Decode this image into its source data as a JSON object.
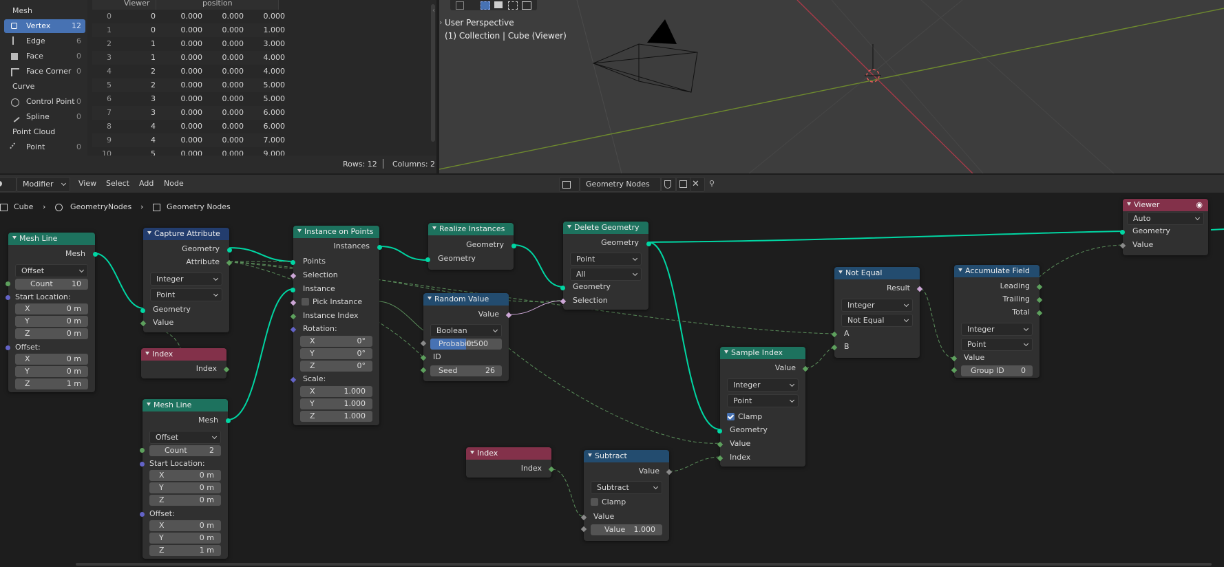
{
  "spreadsheet": {
    "sidebar": {
      "groups": {
        "mesh": "Mesh",
        "curve": "Curve",
        "point_cloud": "Point Cloud"
      },
      "items": {
        "vertex": {
          "label": "Vertex",
          "count": "12"
        },
        "edge": {
          "label": "Edge",
          "count": "6"
        },
        "face": {
          "label": "Face",
          "count": "0"
        },
        "face_corner": {
          "label": "Face Corner",
          "count": "0"
        },
        "control_point": {
          "label": "Control Point",
          "count": "0"
        },
        "spline": {
          "label": "Spline",
          "count": "0"
        },
        "point": {
          "label": "Point",
          "count": "0"
        }
      }
    },
    "columns": {
      "viewer": "Viewer",
      "position": "position"
    },
    "rows": [
      [
        "0",
        "0",
        "0.000",
        "0.000",
        "0.000"
      ],
      [
        "1",
        "0",
        "0.000",
        "0.000",
        "1.000"
      ],
      [
        "2",
        "1",
        "0.000",
        "0.000",
        "3.000"
      ],
      [
        "3",
        "1",
        "0.000",
        "0.000",
        "4.000"
      ],
      [
        "4",
        "2",
        "0.000",
        "0.000",
        "4.000"
      ],
      [
        "5",
        "2",
        "0.000",
        "0.000",
        "5.000"
      ],
      [
        "6",
        "3",
        "0.000",
        "0.000",
        "5.000"
      ],
      [
        "7",
        "3",
        "0.000",
        "0.000",
        "6.000"
      ],
      [
        "8",
        "4",
        "0.000",
        "0.000",
        "6.000"
      ],
      [
        "9",
        "4",
        "0.000",
        "0.000",
        "7.000"
      ],
      [
        "10",
        "5",
        "0.000",
        "0.000",
        "9.000"
      ]
    ],
    "footer": {
      "rows": "Rows: 12",
      "columns": "Columns: 2"
    }
  },
  "viewport": {
    "perspective": "User Perspective",
    "collection": "(1) Collection | Cube (Viewer)"
  },
  "editor": {
    "header": {
      "mode": "Modifier",
      "menus": {
        "view": "View",
        "select": "Select",
        "add": "Add",
        "node": "Node"
      },
      "tree_name": "Geometry Nodes"
    },
    "breadcrumb": {
      "object": "Cube",
      "modifier": "GeometryNodes",
      "tree": "Geometry Nodes"
    }
  },
  "nodes": {
    "mesh_line_1": {
      "title": "Mesh Line",
      "out_mesh": "Mesh",
      "mode": "Offset",
      "count_label": "Count",
      "count": "10",
      "start_location": "Start Location:",
      "offset": "Offset:",
      "start": [
        {
          "axis": "X",
          "val": "0 m"
        },
        {
          "axis": "Y",
          "val": "0 m"
        },
        {
          "axis": "Z",
          "val": "0 m"
        }
      ],
      "off": [
        {
          "axis": "X",
          "val": "0 m"
        },
        {
          "axis": "Y",
          "val": "0 m"
        },
        {
          "axis": "Z",
          "val": "1 m"
        }
      ]
    },
    "capture": {
      "title": "Capture Attribute",
      "out_geometry": "Geometry",
      "out_attribute": "Attribute",
      "type": "Integer",
      "domain": "Point",
      "in_geometry": "Geometry",
      "in_value": "Value"
    },
    "index_1": {
      "title": "Index",
      "out": "Index"
    },
    "mesh_line_2": {
      "title": "Mesh Line",
      "out_mesh": "Mesh",
      "mode": "Offset",
      "count_label": "Count",
      "count": "2",
      "start_location": "Start Location:",
      "offset": "Offset:",
      "start": [
        {
          "axis": "X",
          "val": "0 m"
        },
        {
          "axis": "Y",
          "val": "0 m"
        },
        {
          "axis": "Z",
          "val": "0 m"
        }
      ],
      "off": [
        {
          "axis": "X",
          "val": "0 m"
        },
        {
          "axis": "Y",
          "val": "0 m"
        },
        {
          "axis": "Z",
          "val": "1 m"
        }
      ]
    },
    "iop": {
      "title": "Instance on Points",
      "out_instances": "Instances",
      "points": "Points",
      "selection": "Selection",
      "instance": "Instance",
      "pick_instance": "Pick Instance",
      "instance_index": "Instance Index",
      "rotation": "Rotation:",
      "scale": "Scale:",
      "rot": [
        {
          "axis": "X",
          "val": "0°"
        },
        {
          "axis": "Y",
          "val": "0°"
        },
        {
          "axis": "Z",
          "val": "0°"
        }
      ],
      "scl": [
        {
          "axis": "X",
          "val": "1.000"
        },
        {
          "axis": "Y",
          "val": "1.000"
        },
        {
          "axis": "Z",
          "val": "1.000"
        }
      ]
    },
    "realize": {
      "title": "Realize Instances",
      "out_geometry": "Geometry",
      "in_geometry": "Geometry"
    },
    "random": {
      "title": "Random Value",
      "out_value": "Value",
      "type": "Boolean",
      "probability_label": "Probabilit",
      "probability": "0.500",
      "id": "ID",
      "seed_label": "Seed",
      "seed": "26"
    },
    "delete": {
      "title": "Delete Geometry",
      "out_geometry": "Geometry",
      "domain": "Point",
      "mode": "All",
      "in_geometry": "Geometry",
      "selection": "Selection"
    },
    "index_2": {
      "title": "Index",
      "out": "Index"
    },
    "subtract": {
      "title": "Subtract",
      "out_value": "Value",
      "operation": "Subtract",
      "clamp": "Clamp",
      "in_value": "Value",
      "value_label": "Value",
      "value": "1.000"
    },
    "sample": {
      "title": "Sample Index",
      "out_value": "Value",
      "type": "Integer",
      "domain": "Point",
      "clamp": "Clamp",
      "in_geometry": "Geometry",
      "in_value": "Value",
      "in_index": "Index"
    },
    "not_equal": {
      "title": "Not Equal",
      "out_result": "Result",
      "type": "Integer",
      "mode": "Not Equal",
      "a": "A",
      "b": "B"
    },
    "accumulate": {
      "title": "Accumulate Field",
      "leading": "Leading",
      "trailing": "Trailing",
      "total": "Total",
      "type": "Integer",
      "domain": "Point",
      "in_value": "Value",
      "group_label": "Group ID",
      "group": "0"
    },
    "viewer": {
      "title": "Viewer",
      "domain": "Auto",
      "in_geometry": "Geometry",
      "in_value": "Value"
    }
  }
}
